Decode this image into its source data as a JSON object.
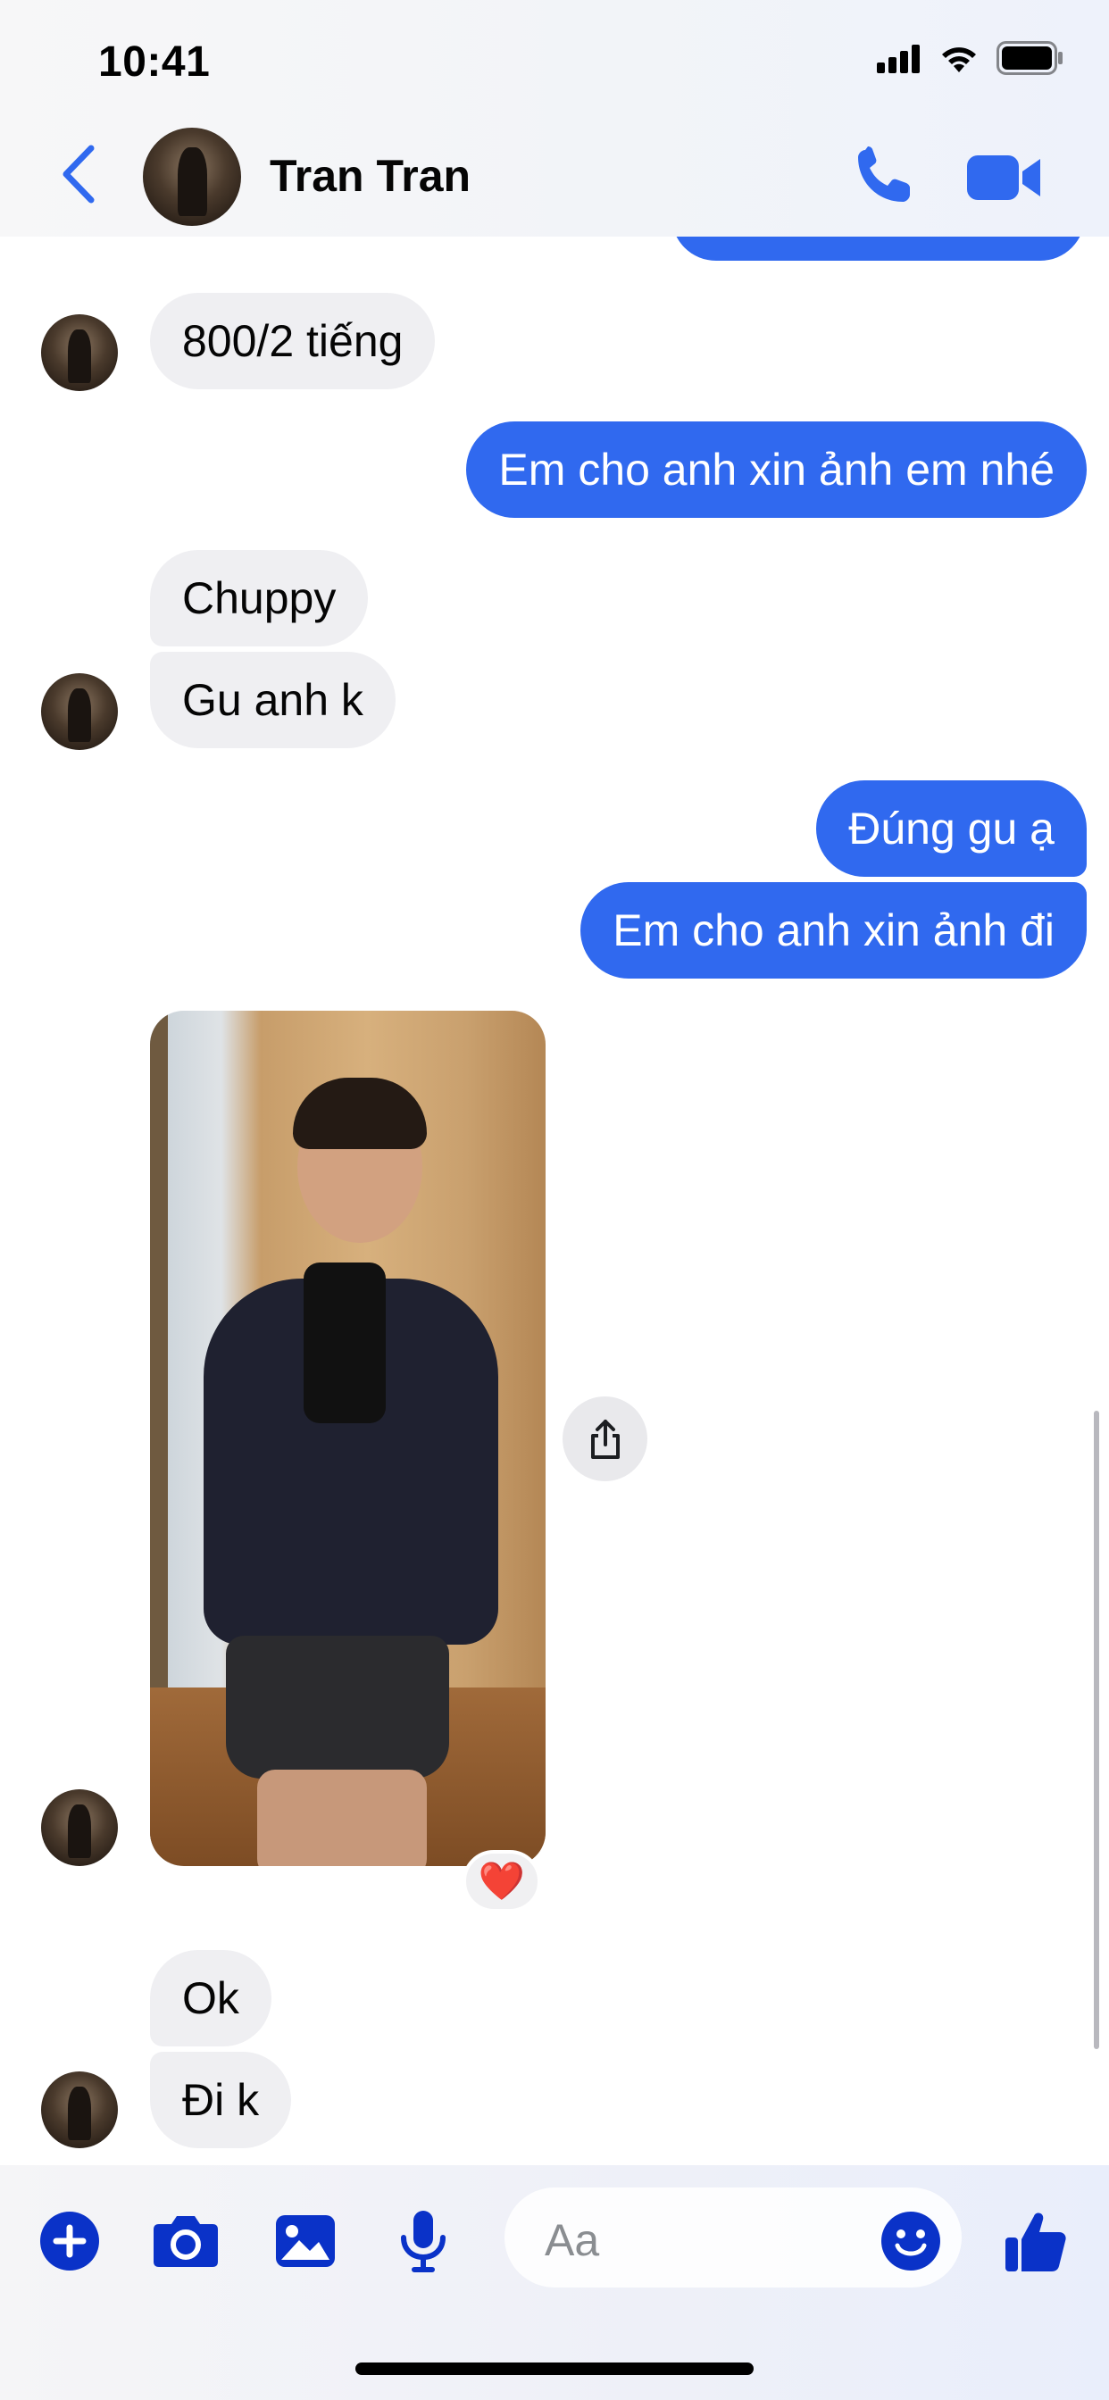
{
  "status_bar": {
    "time": "10:41"
  },
  "header": {
    "contact_name": "Tran Tran"
  },
  "messages": [
    {
      "side": "in",
      "text": "800/2 tiếng"
    },
    {
      "side": "out",
      "text": "Em cho anh xin ảnh em nhé"
    },
    {
      "side": "in",
      "text": "Chuppy"
    },
    {
      "side": "in",
      "text": "Gu anh k"
    },
    {
      "side": "out",
      "text": "Đúng gu ạ"
    },
    {
      "side": "out",
      "text": "Em cho anh xin ảnh đi"
    },
    {
      "side": "in",
      "type": "photo",
      "reaction": "❤️"
    },
    {
      "side": "in",
      "text": "Ok"
    },
    {
      "side": "in",
      "text": "Đi k"
    }
  ],
  "composer": {
    "placeholder": "Aa"
  },
  "colors": {
    "accent": "#3069ef",
    "incoming_bubble": "#efeff2",
    "icon_dark": "#0a32c8"
  }
}
